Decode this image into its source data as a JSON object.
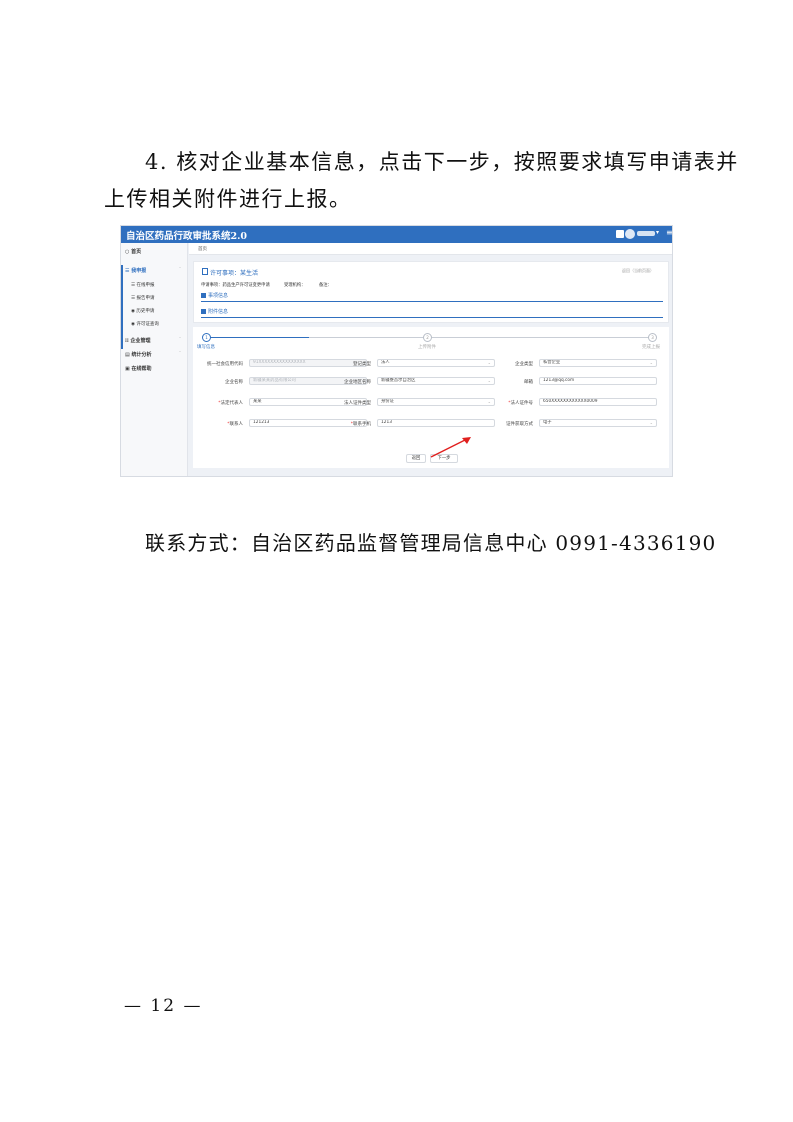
{
  "doc": {
    "para_line1": "4. 核对企业基本信息，点击下一步，按照要求填写申请表并",
    "para_line2": "上传相关附件进行上报。",
    "contact": "联系方式：自治区药品监督管理局信息中心 0991-4336190",
    "page_number": "— 12 —"
  },
  "app": {
    "title": "自治区药品行政审批系统2.0",
    "menu_icon": "menu-icon",
    "message_icon": "message-icon"
  },
  "sidebar": {
    "items": [
      {
        "label": "首页",
        "icon": "home-icon"
      },
      {
        "label": "我申报",
        "icon": "apply-icon"
      },
      {
        "label": "在线申报",
        "icon": "doc-icon"
      },
      {
        "label": "报告申请",
        "icon": "doc-icon"
      },
      {
        "label": "历史申请",
        "icon": "history-icon"
      },
      {
        "label": "许可证查询",
        "icon": "search-icon"
      },
      {
        "label": "企业管理",
        "icon": "grid-icon"
      },
      {
        "label": "统计分析",
        "icon": "chart-icon"
      },
      {
        "label": "在线帮助",
        "icon": "help-icon"
      }
    ]
  },
  "breadcrumb": "首页",
  "license": {
    "title": "许可事项：某生活",
    "back": "返回（当前页面）",
    "apply_item": "申请事项：药品生产许可证变更申请",
    "dept": "受理机构：",
    "status": "备注："
  },
  "sections": {
    "matter": "事项信息",
    "attach": "附件信息"
  },
  "steps": [
    {
      "label": "填写信息",
      "num": "1"
    },
    {
      "label": "上传附件",
      "num": "2"
    },
    {
      "label": "完成上报",
      "num": "3"
    }
  ],
  "form": {
    "credit_code_label": "统一社会信用代码",
    "credit_code_value": "91XXXXXXXXXXXXXXXX",
    "type_label": "登记类型",
    "type_value": "法人",
    "enterprise_type_label": "企业类型",
    "enterprise_type_value": "私营企业",
    "company_label": "企业名称",
    "company_value": "新疆某某药品有限公司",
    "region_label": "企业地区名称",
    "region_value": "新疆维吾尔自治区",
    "email_label": "邮箱",
    "email_value": "1213@qq.com",
    "legal_label": "法定代表人",
    "legal_value": "某某",
    "legal_id_type_label": "法人证件类型",
    "legal_id_type_value": "身份证",
    "legal_id_label": "法人证件号",
    "legal_id_value": "650XXXXXXXXXXXX0009",
    "contact_label": "联系人",
    "contact_value": "121213",
    "phone_label": "联系手机",
    "phone_value": "1213",
    "cert_method_label": "证件获取方式",
    "cert_method_value": "电子"
  },
  "buttons": {
    "back": "返回",
    "next": "下一步"
  }
}
